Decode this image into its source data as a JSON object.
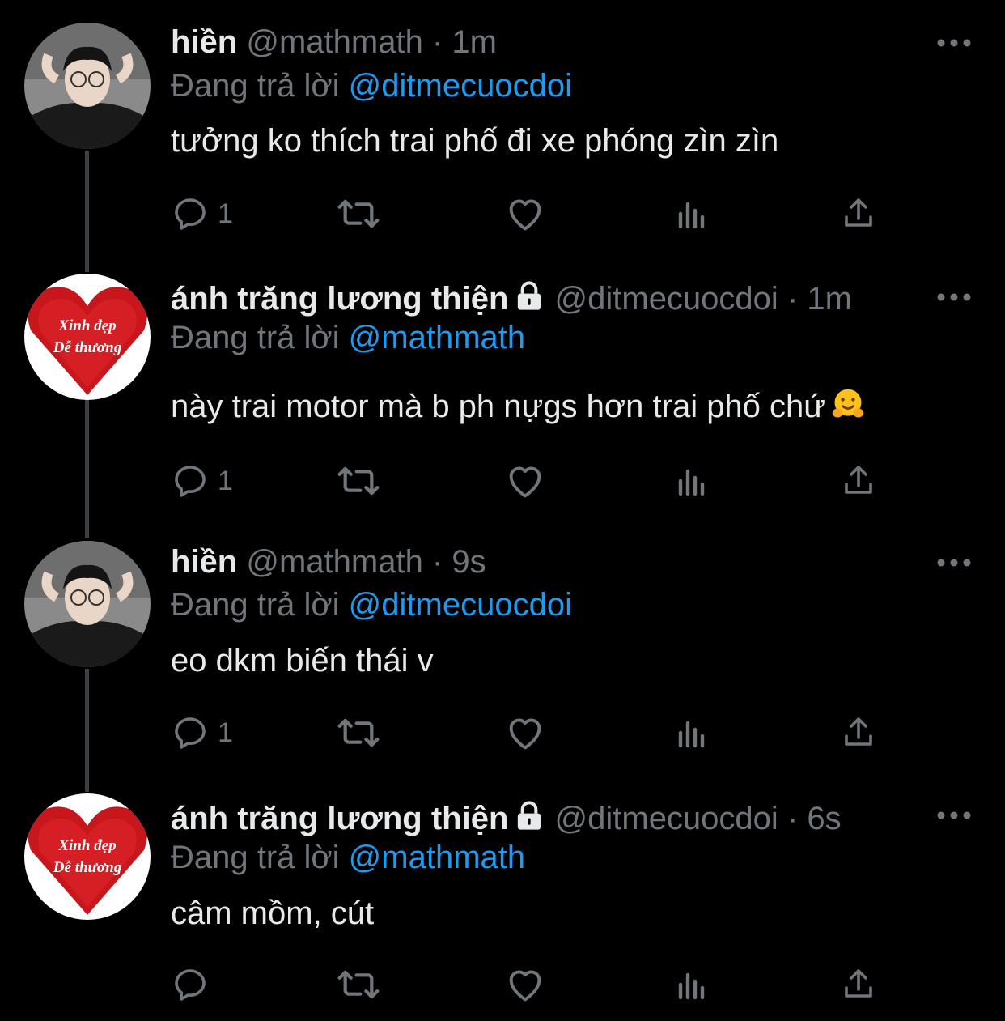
{
  "tweets": [
    {
      "name": "hiền",
      "handle": "@mathmath",
      "time": "1m",
      "replying_prefix": "Đang trả lời",
      "replying_to": "@ditmecuocdoi",
      "text": "tưởng ko thích trai phố đi xe phóng zìn zìn",
      "reply_count": "1",
      "avatar": "photo-icon"
    },
    {
      "name": "ánh trăng lương thiện",
      "handle": "@ditmecuocdoi",
      "time": "1m",
      "replying_prefix": "Đang trả lời",
      "replying_to": "@mathmath",
      "text": "này trai motor mà b ph nựgs hơn trai phố chứ",
      "reply_count": "1",
      "avatar_text_1": "Xinh đẹp",
      "avatar_text_2": "Dễ thương"
    },
    {
      "name": "hiền",
      "handle": "@mathmath",
      "time": "9s",
      "replying_prefix": "Đang trả lời",
      "replying_to": "@ditmecuocdoi",
      "text": "eo dkm biến thái v",
      "reply_count": "1"
    },
    {
      "name": "ánh trăng lương thiện",
      "handle": "@ditmecuocdoi",
      "time": "6s",
      "replying_prefix": "Đang trả lời",
      "replying_to": "@mathmath",
      "text": "câm mồm, cút",
      "reply_count": "",
      "avatar_text_1": "Xinh đẹp",
      "avatar_text_2": "Dễ thương"
    }
  ],
  "separator": "·",
  "colors": {
    "background": "#000000",
    "text": "#e7e9ea",
    "muted": "#71767b",
    "link": "#1d9bf0",
    "thread_line": "#3e4144"
  }
}
